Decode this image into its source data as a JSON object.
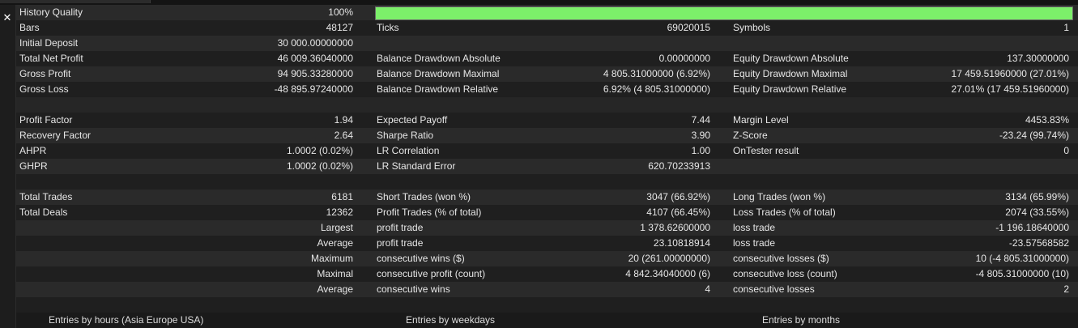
{
  "close_glyph": "✕",
  "history_quality": {
    "label": "History Quality",
    "value": "100%",
    "fill_fraction": 1.0
  },
  "colors": {
    "quality_bar": "#7cf06a",
    "row_even": "#2a2a2a",
    "row_odd": "#1f1f1f"
  },
  "rows": [
    {
      "c1": "Bars",
      "v1": "48127",
      "c2": "Ticks",
      "v2": "69020015",
      "c3": "Symbols",
      "v3": "1"
    },
    {
      "c1": "Initial Deposit",
      "v1": "30 000.00000000",
      "c2": "",
      "v2": "",
      "c3": "",
      "v3": ""
    },
    {
      "c1": "Total Net Profit",
      "v1": "46 009.36040000",
      "c2": "Balance Drawdown Absolute",
      "v2": "0.00000000",
      "c3": "Equity Drawdown Absolute",
      "v3": "137.30000000"
    },
    {
      "c1": "Gross Profit",
      "v1": "94 905.33280000",
      "c2": "Balance Drawdown Maximal",
      "v2": "4 805.31000000 (6.92%)",
      "c3": "Equity Drawdown Maximal",
      "v3": "17 459.51960000 (27.01%)"
    },
    {
      "c1": "Gross Loss",
      "v1": "-48 895.97240000",
      "c2": "Balance Drawdown Relative",
      "v2": "6.92% (4 805.31000000)",
      "c3": "Equity Drawdown Relative",
      "v3": "27.01% (17 459.51960000)"
    },
    {
      "c1": "",
      "v1": "",
      "c2": "",
      "v2": "",
      "c3": "",
      "v3": ""
    },
    {
      "c1": "Profit Factor",
      "v1": "1.94",
      "c2": "Expected Payoff",
      "v2": "7.44",
      "c3": "Margin Level",
      "v3": "4453.83%"
    },
    {
      "c1": "Recovery Factor",
      "v1": "2.64",
      "c2": "Sharpe Ratio",
      "v2": "3.90",
      "c3": "Z-Score",
      "v3": "-23.24 (99.74%)"
    },
    {
      "c1": "AHPR",
      "v1": "1.0002 (0.02%)",
      "c2": "LR Correlation",
      "v2": "1.00",
      "c3": "OnTester result",
      "v3": "0"
    },
    {
      "c1": "GHPR",
      "v1": "1.0002 (0.02%)",
      "c2": "LR Standard Error",
      "v2": "620.70233913",
      "c3": "",
      "v3": ""
    },
    {
      "c1": "",
      "v1": "",
      "c2": "",
      "v2": "",
      "c3": "",
      "v3": ""
    },
    {
      "c1": "Total Trades",
      "v1": "6181",
      "c2": "Short Trades (won %)",
      "v2": "3047 (66.92%)",
      "c3": "Long Trades (won %)",
      "v3": "3134 (65.99%)"
    },
    {
      "c1": "Total Deals",
      "v1": "12362",
      "c2": "Profit Trades (% of total)",
      "v2": "4107 (66.45%)",
      "c3": "Loss Trades (% of total)",
      "v3": "2074 (33.55%)"
    },
    {
      "c1": "",
      "v1": "Largest",
      "c2": "profit trade",
      "v2": "1 378.62600000",
      "c3": "loss trade",
      "v3": "-1 196.18640000"
    },
    {
      "c1": "",
      "v1": "Average",
      "c2": "profit trade",
      "v2": "23.10818914",
      "c3": "loss trade",
      "v3": "-23.57568582"
    },
    {
      "c1": "",
      "v1": "Maximum",
      "c2": "consecutive wins ($)",
      "v2": "20 (261.00000000)",
      "c3": "consecutive losses ($)",
      "v3": "10 (-4 805.31000000)"
    },
    {
      "c1": "",
      "v1": "Maximal",
      "c2": "consecutive profit (count)",
      "v2": "4 842.34040000 (6)",
      "c3": "consecutive loss (count)",
      "v3": "-4 805.31000000 (10)"
    },
    {
      "c1": "",
      "v1": "Average",
      "c2": "consecutive wins",
      "v2": "4",
      "c3": "consecutive losses",
      "v3": "2"
    },
    {
      "c1": "",
      "v1": "",
      "c2": "",
      "v2": "",
      "c3": "",
      "v3": ""
    }
  ],
  "footer": {
    "hours_title": "Entries by hours (Asia Europe USA)",
    "weekdays_title": "Entries by weekdays",
    "months_title": "Entries by months"
  }
}
